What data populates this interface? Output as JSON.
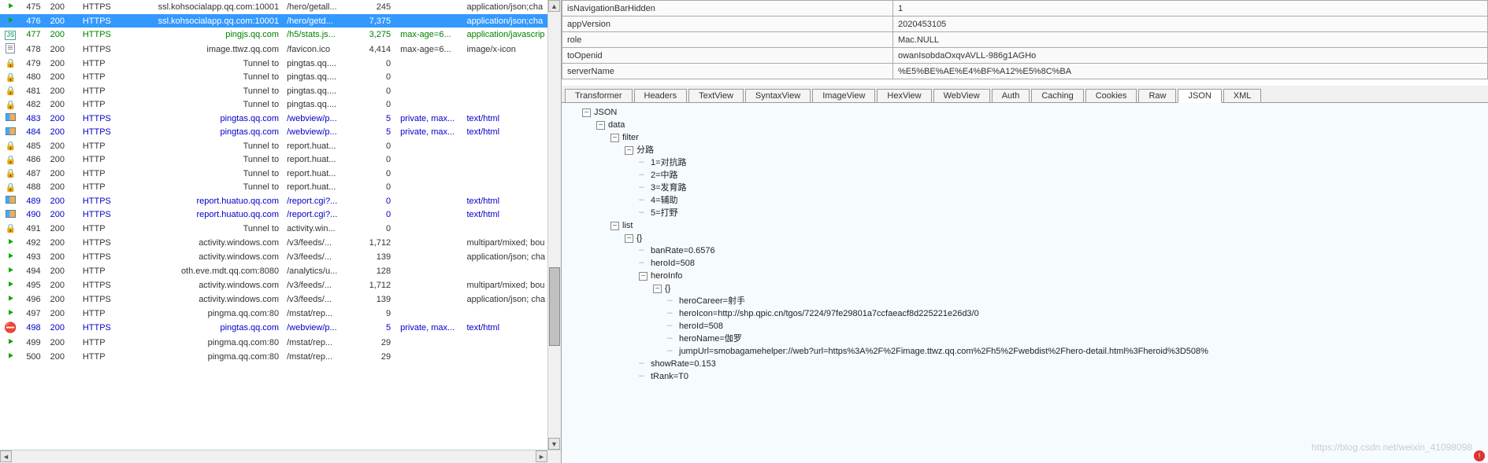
{
  "sessions": {
    "rows": [
      {
        "icon": "green-arrow",
        "id": "475",
        "result": "200",
        "protocol": "HTTPS",
        "host": "ssl.kohsocialapp.qq.com:10001",
        "url": "/hero/getall...",
        "body": "245",
        "caching": "",
        "content": "application/json;cha",
        "style": "",
        "selected": false
      },
      {
        "icon": "green-arrow",
        "id": "476",
        "result": "200",
        "protocol": "HTTPS",
        "host": "ssl.kohsocialapp.qq.com:10001",
        "url": "/hero/getd...",
        "body": "7,375",
        "caching": "",
        "content": "application/json;cha",
        "style": "",
        "selected": true
      },
      {
        "icon": "js",
        "id": "477",
        "result": "200",
        "protocol": "HTTPS",
        "host": "pingjs.qq.com",
        "url": "/h5/stats.js...",
        "body": "3,275",
        "caching": "max-age=6...",
        "content": "application/javascrip",
        "style": "green",
        "selected": false
      },
      {
        "icon": "page",
        "id": "478",
        "result": "200",
        "protocol": "HTTPS",
        "host": "image.ttwz.qq.com",
        "url": "/favicon.ico",
        "body": "4,414",
        "caching": "max-age=6...",
        "content": "image/x-icon",
        "style": "",
        "selected": false
      },
      {
        "icon": "lock",
        "id": "479",
        "result": "200",
        "protocol": "HTTP",
        "host": "Tunnel to",
        "url": "pingtas.qq....",
        "body": "0",
        "caching": "",
        "content": "",
        "style": "",
        "selected": false
      },
      {
        "icon": "lock",
        "id": "480",
        "result": "200",
        "protocol": "HTTP",
        "host": "Tunnel to",
        "url": "pingtas.qq....",
        "body": "0",
        "caching": "",
        "content": "",
        "style": "",
        "selected": false
      },
      {
        "icon": "lock",
        "id": "481",
        "result": "200",
        "protocol": "HTTP",
        "host": "Tunnel to",
        "url": "pingtas.qq....",
        "body": "0",
        "caching": "",
        "content": "",
        "style": "",
        "selected": false
      },
      {
        "icon": "lock",
        "id": "482",
        "result": "200",
        "protocol": "HTTP",
        "host": "Tunnel to",
        "url": "pingtas.qq....",
        "body": "0",
        "caching": "",
        "content": "",
        "style": "",
        "selected": false
      },
      {
        "icon": "blue",
        "id": "483",
        "result": "200",
        "protocol": "HTTPS",
        "host": "pingtas.qq.com",
        "url": "/webview/p...",
        "body": "5",
        "caching": "private, max...",
        "content": "text/html",
        "style": "blue",
        "selected": false
      },
      {
        "icon": "blue",
        "id": "484",
        "result": "200",
        "protocol": "HTTPS",
        "host": "pingtas.qq.com",
        "url": "/webview/p...",
        "body": "5",
        "caching": "private, max...",
        "content": "text/html",
        "style": "blue",
        "selected": false
      },
      {
        "icon": "lock",
        "id": "485",
        "result": "200",
        "protocol": "HTTP",
        "host": "Tunnel to",
        "url": "report.huat...",
        "body": "0",
        "caching": "",
        "content": "",
        "style": "",
        "selected": false
      },
      {
        "icon": "lock",
        "id": "486",
        "result": "200",
        "protocol": "HTTP",
        "host": "Tunnel to",
        "url": "report.huat...",
        "body": "0",
        "caching": "",
        "content": "",
        "style": "",
        "selected": false
      },
      {
        "icon": "lock",
        "id": "487",
        "result": "200",
        "protocol": "HTTP",
        "host": "Tunnel to",
        "url": "report.huat...",
        "body": "0",
        "caching": "",
        "content": "",
        "style": "",
        "selected": false
      },
      {
        "icon": "lock",
        "id": "488",
        "result": "200",
        "protocol": "HTTP",
        "host": "Tunnel to",
        "url": "report.huat...",
        "body": "0",
        "caching": "",
        "content": "",
        "style": "",
        "selected": false
      },
      {
        "icon": "blue",
        "id": "489",
        "result": "200",
        "protocol": "HTTPS",
        "host": "report.huatuo.qq.com",
        "url": "/report.cgi?...",
        "body": "0",
        "caching": "",
        "content": "text/html",
        "style": "blue",
        "selected": false
      },
      {
        "icon": "blue",
        "id": "490",
        "result": "200",
        "protocol": "HTTPS",
        "host": "report.huatuo.qq.com",
        "url": "/report.cgi?...",
        "body": "0",
        "caching": "",
        "content": "text/html",
        "style": "blue",
        "selected": false
      },
      {
        "icon": "lock",
        "id": "491",
        "result": "200",
        "protocol": "HTTP",
        "host": "Tunnel to",
        "url": "activity.win...",
        "body": "0",
        "caching": "",
        "content": "",
        "style": "",
        "selected": false
      },
      {
        "icon": "green-arrow",
        "id": "492",
        "result": "200",
        "protocol": "HTTPS",
        "host": "activity.windows.com",
        "url": "/v3/feeds/...",
        "body": "1,712",
        "caching": "",
        "content": "multipart/mixed; bou",
        "style": "",
        "selected": false
      },
      {
        "icon": "green-arrow",
        "id": "493",
        "result": "200",
        "protocol": "HTTPS",
        "host": "activity.windows.com",
        "url": "/v3/feeds/...",
        "body": "139",
        "caching": "",
        "content": "application/json; cha",
        "style": "",
        "selected": false
      },
      {
        "icon": "green-arrow",
        "id": "494",
        "result": "200",
        "protocol": "HTTP",
        "host": "oth.eve.mdt.qq.com:8080",
        "url": "/analytics/u...",
        "body": "128",
        "caching": "",
        "content": "",
        "style": "",
        "selected": false
      },
      {
        "icon": "green-arrow",
        "id": "495",
        "result": "200",
        "protocol": "HTTPS",
        "host": "activity.windows.com",
        "url": "/v3/feeds/...",
        "body": "1,712",
        "caching": "",
        "content": "multipart/mixed; bou",
        "style": "",
        "selected": false
      },
      {
        "icon": "green-arrow",
        "id": "496",
        "result": "200",
        "protocol": "HTTPS",
        "host": "activity.windows.com",
        "url": "/v3/feeds/...",
        "body": "139",
        "caching": "",
        "content": "application/json; cha",
        "style": "",
        "selected": false
      },
      {
        "icon": "green-arrow",
        "id": "497",
        "result": "200",
        "protocol": "HTTP",
        "host": "pingma.qq.com:80",
        "url": "/mstat/rep...",
        "body": "9",
        "caching": "",
        "content": "",
        "style": "",
        "selected": false
      },
      {
        "icon": "red",
        "id": "498",
        "result": "200",
        "protocol": "HTTPS",
        "host": "pingtas.qq.com",
        "url": "/webview/p...",
        "body": "5",
        "caching": "private, max...",
        "content": "text/html",
        "style": "blue",
        "selected": false
      },
      {
        "icon": "green-arrow",
        "id": "499",
        "result": "200",
        "protocol": "HTTP",
        "host": "pingma.qq.com:80",
        "url": "/mstat/rep...",
        "body": "29",
        "caching": "",
        "content": "",
        "style": "",
        "selected": false
      },
      {
        "icon": "green-arrow",
        "id": "500",
        "result": "200",
        "protocol": "HTTP",
        "host": "pingma.qq.com:80",
        "url": "/mstat/rep...",
        "body": "29",
        "caching": "",
        "content": "",
        "style": "",
        "selected": false
      }
    ]
  },
  "props": [
    {
      "key": "isNavigationBarHidden",
      "value": "1"
    },
    {
      "key": "appVersion",
      "value": "2020453105"
    },
    {
      "key": "role",
      "value": "Mac.NULL"
    },
    {
      "key": "toOpenid",
      "value": "owanIsobdaOxqvAVLL-986g1AGHo"
    },
    {
      "key": "serverName",
      "value": "%E5%BE%AE%E4%BF%A12%E5%8C%BA"
    }
  ],
  "tabs": [
    "Transformer",
    "Headers",
    "TextView",
    "SyntaxView",
    "ImageView",
    "HexView",
    "WebView",
    "Auth",
    "Caching",
    "Cookies",
    "Raw",
    "JSON",
    "XML"
  ],
  "activeTab": "JSON",
  "tree": {
    "root": "JSON",
    "data": "data",
    "filter": "filter",
    "filterGroup": "分路",
    "filterItems": [
      "1=对抗路",
      "2=中路",
      "3=发育路",
      "4=辅助",
      "5=打野"
    ],
    "list": "list",
    "brace": "{}",
    "banRate": "banRate=0.6576",
    "heroId1": "heroId=508",
    "heroInfo": "heroInfo",
    "heroCareer": "heroCareer=射手",
    "heroIcon": "heroIcon=http://shp.qpic.cn/tgos/7224/97fe29801a7ccfaeacf8d225221e26d3/0",
    "heroId2": "heroId=508",
    "heroName": "heroName=伽罗",
    "jumpUrl": "jumpUrl=smobagamehelper://web?url=https%3A%2F%2Fimage.ttwz.qq.com%2Fh5%2Fwebdist%2Fhero-detail.html%3Fheroid%3D508%",
    "showRate": "showRate=0.153",
    "tRank": "tRank=T0"
  },
  "watermark": "https://blog.csdn.net/weixin_41098098"
}
